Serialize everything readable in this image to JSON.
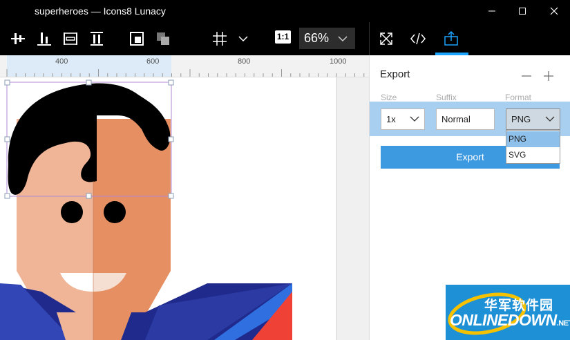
{
  "window": {
    "title": "superheroes — Icons8 Lunacy"
  },
  "toolbar": {
    "one_to_one_label": "1:1",
    "zoom_value": "66%"
  },
  "ruler": {
    "labels": [
      "400",
      "600",
      "800",
      "1000"
    ]
  },
  "export_panel": {
    "title": "Export",
    "columns": {
      "size": "Size",
      "suffix": "Suffix",
      "format": "Format"
    },
    "size_value": "1x",
    "suffix_value": "Normal",
    "format_value": "PNG",
    "format_options": [
      "PNG",
      "SVG"
    ],
    "export_button": "Export"
  },
  "watermark": {
    "cn": "华军软件园",
    "en": "ONLINEDOWN",
    "suffix": ".NET"
  },
  "colors": {
    "accent": "#1aa3ff",
    "export_button": "#3d9ae0",
    "selected_row": "#a8cff0",
    "skin_light": "#efb596",
    "skin_dark": "#e68f62",
    "hair": "#000000",
    "suit_blue": "#1f2a8c",
    "cape_red": "#ef4136"
  }
}
